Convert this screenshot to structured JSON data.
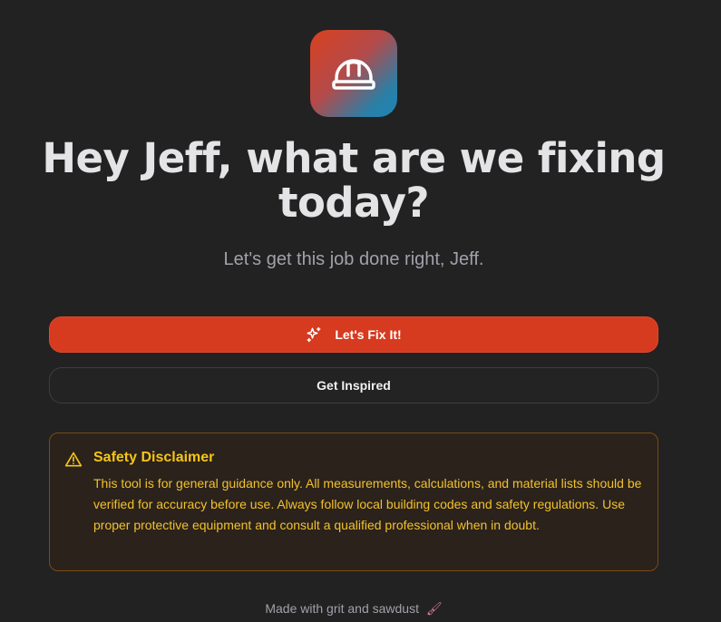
{
  "logo": {
    "icon": "hard-hat-icon"
  },
  "headline": "Hey Jeff, what are we fixing today?",
  "subtitle": "Let's get this job done right, Jeff.",
  "primary_button": {
    "label": "Let's Fix It!",
    "icon": "sparkles-icon",
    "color": "#d63a1f"
  },
  "secondary_button": {
    "label": "Get Inspired"
  },
  "disclaimer": {
    "icon": "warning-triangle-icon",
    "title": "Safety Disclaimer",
    "body": "This tool is for general guidance only. All measurements, calculations, and material lists should be verified for accuracy before use. Always follow local building codes and safety regulations. Use proper protective equipment and consult a qualified professional when in doubt.",
    "accent_color": "#f5c518"
  },
  "footer": {
    "text": "Made with grit and sawdust",
    "icon": "paintbrush-icon"
  }
}
